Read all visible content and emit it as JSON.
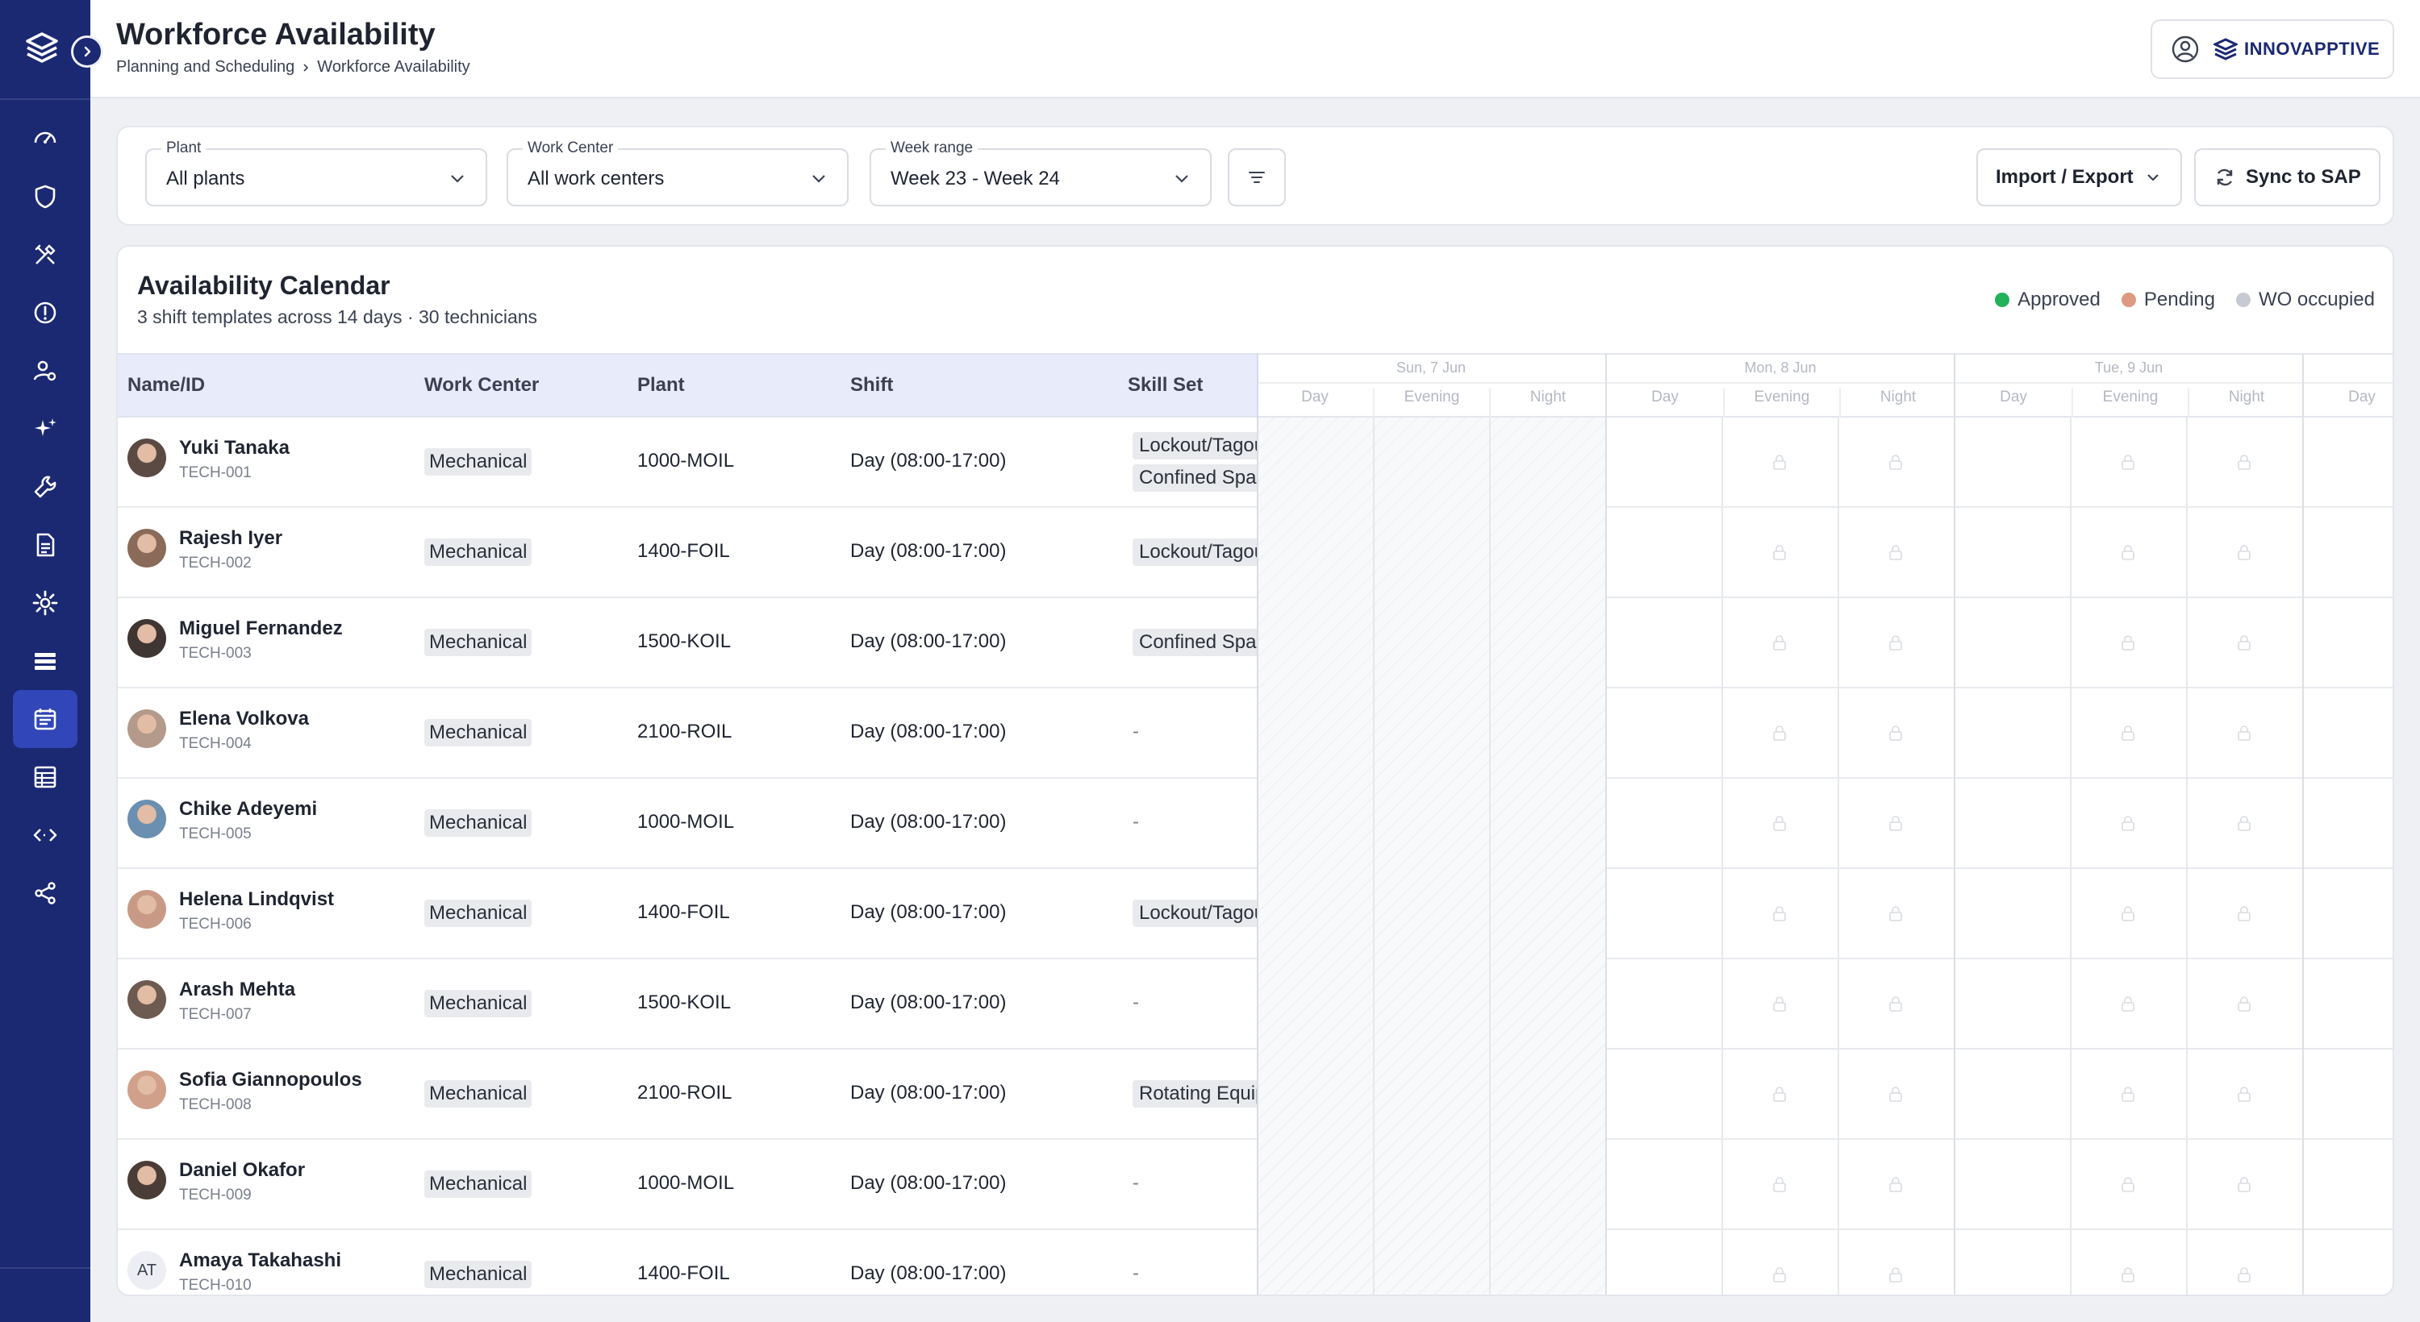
{
  "app": {
    "title": "Workforce Availability"
  },
  "breadcrumb": [
    "Planning and Scheduling",
    "Workforce Availability"
  ],
  "brand": {
    "name": "INNOVAPPTIVE"
  },
  "sidebar": {
    "items": [
      {
        "icon": "dashboard-icon"
      },
      {
        "icon": "shield-icon"
      },
      {
        "icon": "tools-icon"
      },
      {
        "icon": "alert-icon"
      },
      {
        "icon": "user-settings-icon"
      },
      {
        "icon": "sparkle-icon"
      },
      {
        "icon": "wrench-icon"
      },
      {
        "icon": "document-icon"
      },
      {
        "icon": "gear-icon"
      },
      {
        "icon": "list-icon"
      },
      {
        "icon": "calendar-icon",
        "active": true
      },
      {
        "icon": "table-icon"
      },
      {
        "icon": "code-icon"
      },
      {
        "icon": "share-icon"
      }
    ]
  },
  "filters": {
    "plant": {
      "label": "Plant",
      "value": "All plants"
    },
    "work_center": {
      "label": "Work Center",
      "value": "All work centers"
    },
    "week_range": {
      "label": "Week range",
      "value": "Week 23 - Week 24"
    },
    "import_export": "Import / Export",
    "sync": "Sync to SAP"
  },
  "calendar": {
    "title": "Availability Calendar",
    "subtitle": "3 shift templates across 14 days · 30 technicians",
    "legend": [
      {
        "label": "Approved",
        "color": "#22b25a"
      },
      {
        "label": "Pending",
        "color": "#dc9a80"
      },
      {
        "label": "WO occupied",
        "color": "#c7cad1"
      }
    ],
    "columns": [
      "Name/ID",
      "Work Center",
      "Plant",
      "Shift",
      "Skill Set"
    ],
    "days": [
      {
        "label": "Sun, 7 Jun",
        "slots": [
          "Day",
          "Evening",
          "Night"
        ]
      },
      {
        "label": "Mon, 8 Jun",
        "slots": [
          "Day",
          "Evening",
          "Night"
        ]
      },
      {
        "label": "Tue, 9 Jun",
        "slots": [
          "Day",
          "Evening",
          "Night"
        ]
      },
      {
        "label": "",
        "slots": [
          "Day"
        ]
      }
    ],
    "rows": [
      {
        "name": "Yuki Tanaka",
        "id": "TECH-001",
        "wc": "Mechanical",
        "plant": "1000-MOIL",
        "shift": "Day (08:00-17:00)",
        "skills": [
          "Lockout/Tagout",
          "Confined Space"
        ]
      },
      {
        "name": "Rajesh Iyer",
        "id": "TECH-002",
        "wc": "Mechanical",
        "plant": "1400-FOIL",
        "shift": "Day (08:00-17:00)",
        "skills": [
          "Lockout/Tagout"
        ]
      },
      {
        "name": "Miguel Fernandez",
        "id": "TECH-003",
        "wc": "Mechanical",
        "plant": "1500-KOIL",
        "shift": "Day (08:00-17:00)",
        "skills": [
          "Confined Space"
        ]
      },
      {
        "name": "Elena Volkova",
        "id": "TECH-004",
        "wc": "Mechanical",
        "plant": "2100-ROIL",
        "shift": "Day (08:00-17:00)",
        "skills": []
      },
      {
        "name": "Chike Adeyemi",
        "id": "TECH-005",
        "wc": "Mechanical",
        "plant": "1000-MOIL",
        "shift": "Day (08:00-17:00)",
        "skills": []
      },
      {
        "name": "Helena Lindqvist",
        "id": "TECH-006",
        "wc": "Mechanical",
        "plant": "1400-FOIL",
        "shift": "Day (08:00-17:00)",
        "skills": [
          "Lockout/Tagout"
        ]
      },
      {
        "name": "Arash Mehta",
        "id": "TECH-007",
        "wc": "Mechanical",
        "plant": "1500-KOIL",
        "shift": "Day (08:00-17:00)",
        "skills": []
      },
      {
        "name": "Sofia Giannopoulos",
        "id": "TECH-008",
        "wc": "Mechanical",
        "plant": "2100-ROIL",
        "shift": "Day (08:00-17:00)",
        "skills": [
          "Rotating Equipment"
        ]
      },
      {
        "name": "Daniel Okafor",
        "id": "TECH-009",
        "wc": "Mechanical",
        "plant": "1000-MOIL",
        "shift": "Day (08:00-17:00)",
        "skills": []
      },
      {
        "name": "Amaya Takahashi",
        "id": "TECH-010",
        "wc": "Mechanical",
        "plant": "1400-FOIL",
        "shift": "Day (08:00-17:00)",
        "skills": [],
        "initials": "AT"
      }
    ],
    "empty_skill": "-"
  }
}
